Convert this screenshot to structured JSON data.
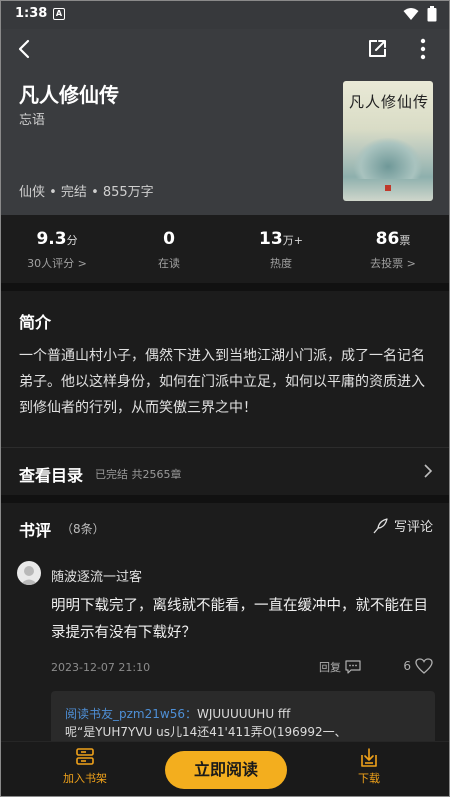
{
  "status_bar": {
    "time": "1:38",
    "notif": "A"
  },
  "book": {
    "title": "凡人修仙传",
    "author": "忘语",
    "meta": "仙侠 • 完结 • 855万字",
    "cover_title": "凡人修仙传"
  },
  "stats": [
    {
      "value": "9.3",
      "unit": "分",
      "label": "30人评分 >"
    },
    {
      "value": "0",
      "unit": "",
      "label": "在读"
    },
    {
      "value": "13",
      "unit": "万+",
      "label": "热度"
    },
    {
      "value": "86",
      "unit": "票",
      "label": "去投票 >"
    }
  ],
  "intro": {
    "heading": "简介",
    "text": "一个普通山村小子，偶然下进入到当地江湖小门派，成了一名记名弟子。他以这样身份，如何在门派中立足，如何以平庸的资质进入到修仙者的行列，从而笑傲三界之中！"
  },
  "catalog": {
    "heading": "查看目录",
    "sub": "已完结 共2565章"
  },
  "reviews": {
    "heading": "书评",
    "count": "（8条）",
    "write_label": "写评论",
    "items": [
      {
        "user": "随波逐流一过客",
        "text": "明明下载完了，离线就不能看，一直在缓冲中，就不能在目录提示有没有下载好？",
        "date": "2023-12-07 21:10",
        "reply_label": "回复",
        "likes": "6",
        "sub_reply": {
          "who": "阅读书友_pzm21w56：",
          "text": "WJUUUUUHU fff",
          "text2": "呢“是YUH7YVU us儿14还41'411弄O(196992一、"
        }
      }
    ]
  },
  "bottom_bar": {
    "shelf_label": "加入书架",
    "read_label": "立即阅读",
    "download_label": "下载"
  },
  "colors": {
    "accent": "#f3ae1e",
    "link": "#4e8fd6"
  }
}
